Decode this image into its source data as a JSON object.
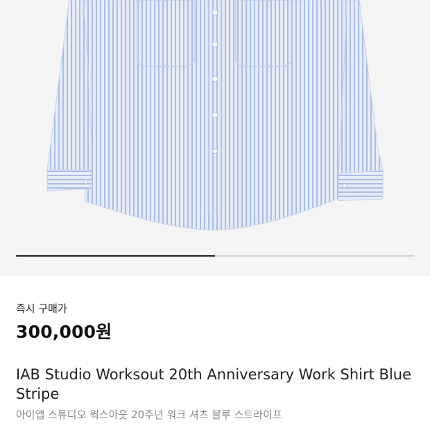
{
  "product": {
    "image_alt": "product-photo-shirt",
    "pager_progress": 0.5,
    "price_label": "즉시 구매가",
    "price": "300,000원",
    "title_en": "IAB Studio Worksout 20th Anniversary Work Shirt Blue Stripe",
    "title_ko": "아이앱 스튜디오 웍스아웃 20주년 워크 셔츠 블루 스트라이프"
  },
  "colors": {
    "background_image": "#f4f4f4",
    "shirt_base": "#e6ecf8",
    "shirt_stripe": "#a9bde6",
    "pager_active": "#222222",
    "pager_track": "#d6d6d6"
  }
}
